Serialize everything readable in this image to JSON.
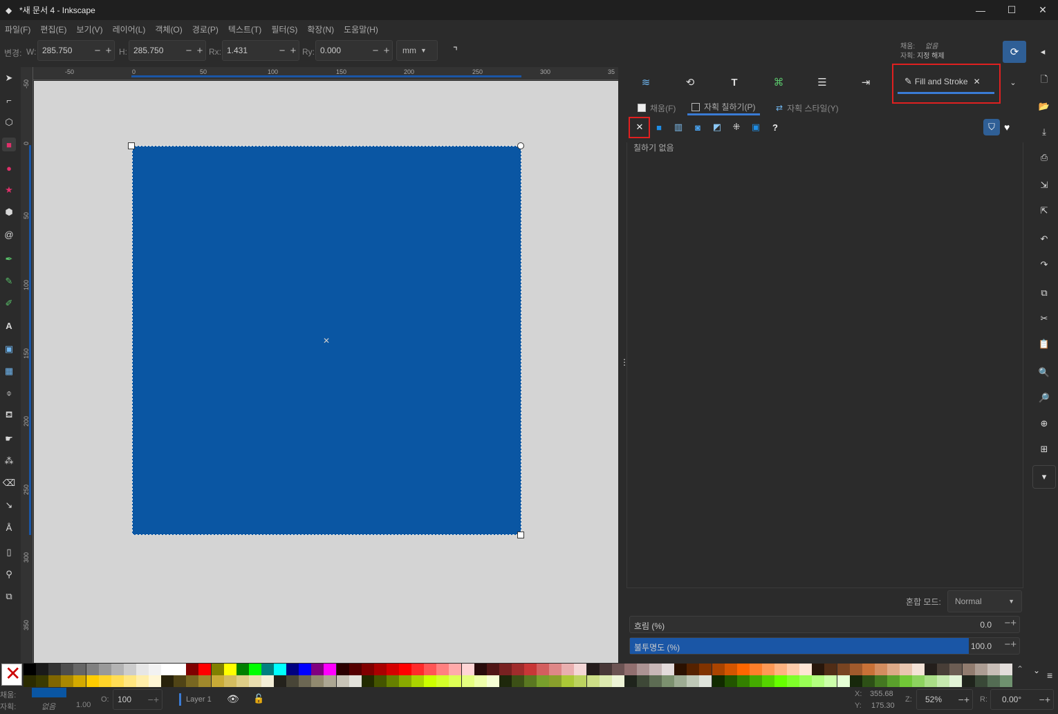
{
  "window": {
    "title": "*새 문서 4 - Inkscape",
    "minimize": "—",
    "maximize": "☐",
    "close": "✕"
  },
  "menu": [
    "파일(F)",
    "편집(E)",
    "보기(V)",
    "레이어(L)",
    "객체(O)",
    "경로(P)",
    "텍스트(T)",
    "필터(S)",
    "확장(N)",
    "도움말(H)"
  ],
  "toolctl": {
    "change_label": "변경:",
    "w_label": "W:",
    "w_value": "285.750",
    "h_label": "H:",
    "h_value": "285.750",
    "rx_label": "Rx:",
    "rx_value": "1.431",
    "ry_label": "Ry:",
    "ry_value": "0.000",
    "unit": "mm",
    "fill_label": "채움:",
    "fill_value": "없음",
    "stroke_label": "자획:",
    "stroke_value": "지정 해제"
  },
  "rulers": {
    "h_ticks": [
      "-50",
      "0",
      "50",
      "100",
      "150",
      "200",
      "250",
      "300",
      "35"
    ],
    "v_ticks": [
      "-50",
      "0",
      "50",
      "100",
      "150",
      "200",
      "250",
      "300",
      "350"
    ]
  },
  "panel": {
    "tab_label": "Fill and Stroke",
    "subtab_fill": "채움(F)",
    "subtab_stroke_paint": "자획 칠하기(P)",
    "subtab_stroke_style": "자획 스타일(Y)",
    "paint_state": "칠하기 없음",
    "blend_label": "혼합 모드:",
    "blend_value": "Normal",
    "blur_label": "흐림 (%)",
    "blur_value": "0.0",
    "blur_fraction": 0.0,
    "opacity_label": "불투명도 (%)",
    "opacity_value": "100.0",
    "opacity_fraction": 1.0
  },
  "status": {
    "fill_label": "채움:",
    "stroke_label": "자획:",
    "stroke_value": "없음",
    "stroke_width": "1.00",
    "fill_color": "#0a56a3",
    "opacity_label": "O:",
    "opacity_value": "100",
    "layer": "Layer 1",
    "x_label": "X:",
    "x_value": "355.68",
    "y_label": "Y:",
    "y_value": "175.30",
    "zoom_label": "Z:",
    "zoom_value": "52%",
    "rotate_label": "R:",
    "rotate_value": "0.00°"
  },
  "colors": {
    "rect_fill": "#0a56a3",
    "accent": "#3a7bd5",
    "highlight": "#e02020"
  },
  "palette_row1": [
    "#000000",
    "#1a1a1a",
    "#333333",
    "#4d4d4d",
    "#666666",
    "#808080",
    "#999999",
    "#b3b3b3",
    "#cccccc",
    "#e6e6e6",
    "#f2f2f2",
    "#ffffff",
    "#ffffff",
    "#800000",
    "#ff0000",
    "#808000",
    "#ffff00",
    "#008000",
    "#00ff00",
    "#008080",
    "#00ffff",
    "#000080",
    "#0000ff",
    "#800080",
    "#ff00ff",
    "#2b0000",
    "#550000",
    "#800000",
    "#aa0000",
    "#d40000",
    "#ff0000",
    "#ff2a2a",
    "#ff5555",
    "#ff8080",
    "#ffaaaa",
    "#ffd5d5",
    "#280b0b",
    "#501616",
    "#782121",
    "#a02c2c",
    "#c83737",
    "#d35f5f",
    "#de8787",
    "#e9afaf",
    "#f4d7d7",
    "#241c1c",
    "#483737",
    "#6c5353",
    "#916f6f",
    "#ac9393",
    "#c8b7b7",
    "#e3dbdb",
    "#2b1100",
    "#552200",
    "#803300",
    "#aa4400",
    "#d45500",
    "#ff6600",
    "#ff7f2a",
    "#ff9955",
    "#ffb380",
    "#ffccaa",
    "#ffe6d5",
    "#28170b",
    "#502d16",
    "#784421",
    "#a05a2c",
    "#c87137",
    "#d38d5f",
    "#deaa87",
    "#e9c6af",
    "#f4e3d7",
    "#241f1c",
    "#483e37",
    "#6c5d53",
    "#917c6f",
    "#ac9d93",
    "#c8beb7",
    "#e3dedb",
    "#2b2200",
    "#554400"
  ],
  "palette_row2": [
    "#2b2b00",
    "#3a3a00",
    "#806600",
    "#aa8800",
    "#d4aa00",
    "#ffcc00",
    "#ffd42a",
    "#ffdd55",
    "#ffe680",
    "#ffeeaa",
    "#fff6d5",
    "#28220b",
    "#504416",
    "#786721",
    "#a0892c",
    "#c8ab37",
    "#d3bc5f",
    "#decd87",
    "#e9ddaf",
    "#f4eed7",
    "#24221c",
    "#484537",
    "#6c6753",
    "#918a6f",
    "#aca793",
    "#c8c4b7",
    "#e3e2db",
    "#222b00",
    "#445500",
    "#668000",
    "#88aa00",
    "#aad400",
    "#ccff00",
    "#d4ff2a",
    "#ddff55",
    "#e5ff80",
    "#eeffaa",
    "#f6ffd5",
    "#1e280b",
    "#3c5016",
    "#5a7821",
    "#78a02c",
    "#89a02c",
    "#abc837",
    "#bcd35f",
    "#cdde87",
    "#dde9af",
    "#eef4d7",
    "#1f241c",
    "#3e4837",
    "#5d6c53",
    "#7c916f",
    "#9dac93",
    "#bec8b7",
    "#dee3db",
    "#112b00",
    "#225500",
    "#338000",
    "#44aa00",
    "#55d400",
    "#66ff00",
    "#7fff2a",
    "#99ff55",
    "#b3ff80",
    "#ccffaa",
    "#e5ffd5",
    "#17280b",
    "#2d5016",
    "#447821",
    "#5aa02c",
    "#71c837",
    "#8dd35f",
    "#aade87",
    "#c6e9af",
    "#e3f4d7",
    "#1f241c",
    "#394837",
    "#536c53",
    "#6f916f",
    "#93ac93",
    "#b7c8b7"
  ]
}
